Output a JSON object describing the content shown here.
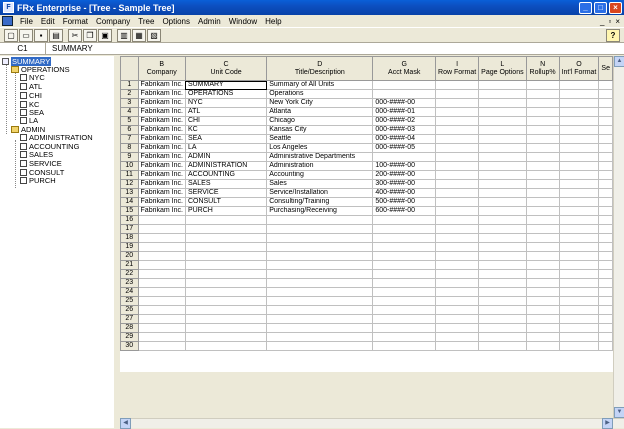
{
  "window": {
    "title": "FRx Enterprise - [Tree - Sample Tree]"
  },
  "menu": [
    "File",
    "Edit",
    "Format",
    "Company",
    "Tree",
    "Options",
    "Admin",
    "Window",
    "Help"
  ],
  "toolbar": {
    "buttons": [
      "new-icon",
      "open-icon",
      "save-icon",
      "print-icon",
      "cut-icon",
      "copy-icon",
      "paste-icon",
      "print-preview-icon",
      "book-icon",
      "report-icon"
    ],
    "help_icon": "help-icon"
  },
  "cellbar": {
    "ref": "C1",
    "value": "SUMMARY"
  },
  "tree": {
    "root": "SUMMARY",
    "operations": {
      "label": "OPERATIONS",
      "children": [
        "NYC",
        "ATL",
        "CHI",
        "KC",
        "SEA",
        "LA"
      ]
    },
    "admin": {
      "label": "ADMIN",
      "children": [
        "ADMINISTRATION",
        "ACCOUNTING",
        "SALES",
        "SERVICE",
        "CONSULT",
        "PURCH"
      ]
    }
  },
  "grid": {
    "columns": [
      {
        "letter": "B",
        "name": "Company"
      },
      {
        "letter": "C",
        "name": "Unit Code"
      },
      {
        "letter": "D",
        "name": "Title/Description"
      },
      {
        "letter": "G",
        "name": "Acct Mask"
      },
      {
        "letter": "I",
        "name": "Row Format"
      },
      {
        "letter": "L",
        "name": "Page Options"
      },
      {
        "letter": "N",
        "name": "Rollup%"
      },
      {
        "letter": "O",
        "name": "Int'l Format"
      },
      {
        "letter": "",
        "name": "Se"
      }
    ],
    "rows": [
      [
        "Fabrikam Inc.",
        "SUMMARY",
        "Summary of All Units",
        "",
        "",
        "",
        "",
        "",
        ""
      ],
      [
        "Fabrikam Inc.",
        "OPERATIONS",
        "Operations",
        "",
        "",
        "",
        "",
        "",
        ""
      ],
      [
        "Fabrikam Inc.",
        "NYC",
        "New York City",
        "000-####-00",
        "",
        "",
        "",
        "",
        ""
      ],
      [
        "Fabrikam Inc.",
        "ATL",
        "Atlanta",
        "000-####-01",
        "",
        "",
        "",
        "",
        ""
      ],
      [
        "Fabrikam Inc.",
        "CHI",
        "Chicago",
        "000-####-02",
        "",
        "",
        "",
        "",
        ""
      ],
      [
        "Fabrikam Inc.",
        "KC",
        "Kansas City",
        "000-####-03",
        "",
        "",
        "",
        "",
        ""
      ],
      [
        "Fabrikam Inc.",
        "SEA",
        "Seattle",
        "000-####-04",
        "",
        "",
        "",
        "",
        ""
      ],
      [
        "Fabrikam Inc.",
        "LA",
        "Los Angeles",
        "000-####-05",
        "",
        "",
        "",
        "",
        ""
      ],
      [
        "Fabrikam Inc.",
        "ADMIN",
        "Administrative Departments",
        "",
        "",
        "",
        "",
        "",
        ""
      ],
      [
        "Fabrikam Inc.",
        "ADMINISTRATION",
        "Administration",
        "100-####-00",
        "",
        "",
        "",
        "",
        ""
      ],
      [
        "Fabrikam Inc.",
        "ACCOUNTING",
        "Accounting",
        "200-####-00",
        "",
        "",
        "",
        "",
        ""
      ],
      [
        "Fabrikam Inc.",
        "SALES",
        "Sales",
        "300-####-00",
        "",
        "",
        "",
        "",
        ""
      ],
      [
        "Fabrikam Inc.",
        "SERVICE",
        "Service/Installation",
        "400-####-00",
        "",
        "",
        "",
        "",
        ""
      ],
      [
        "Fabrikam Inc.",
        "CONSULT",
        "Consulting/Training",
        "500-####-00",
        "",
        "",
        "",
        "",
        ""
      ],
      [
        "Fabrikam Inc.",
        "PURCH",
        "Purchasing/Receiving",
        "600-####-00",
        "",
        "",
        "",
        "",
        ""
      ]
    ],
    "total_rows": 30
  }
}
